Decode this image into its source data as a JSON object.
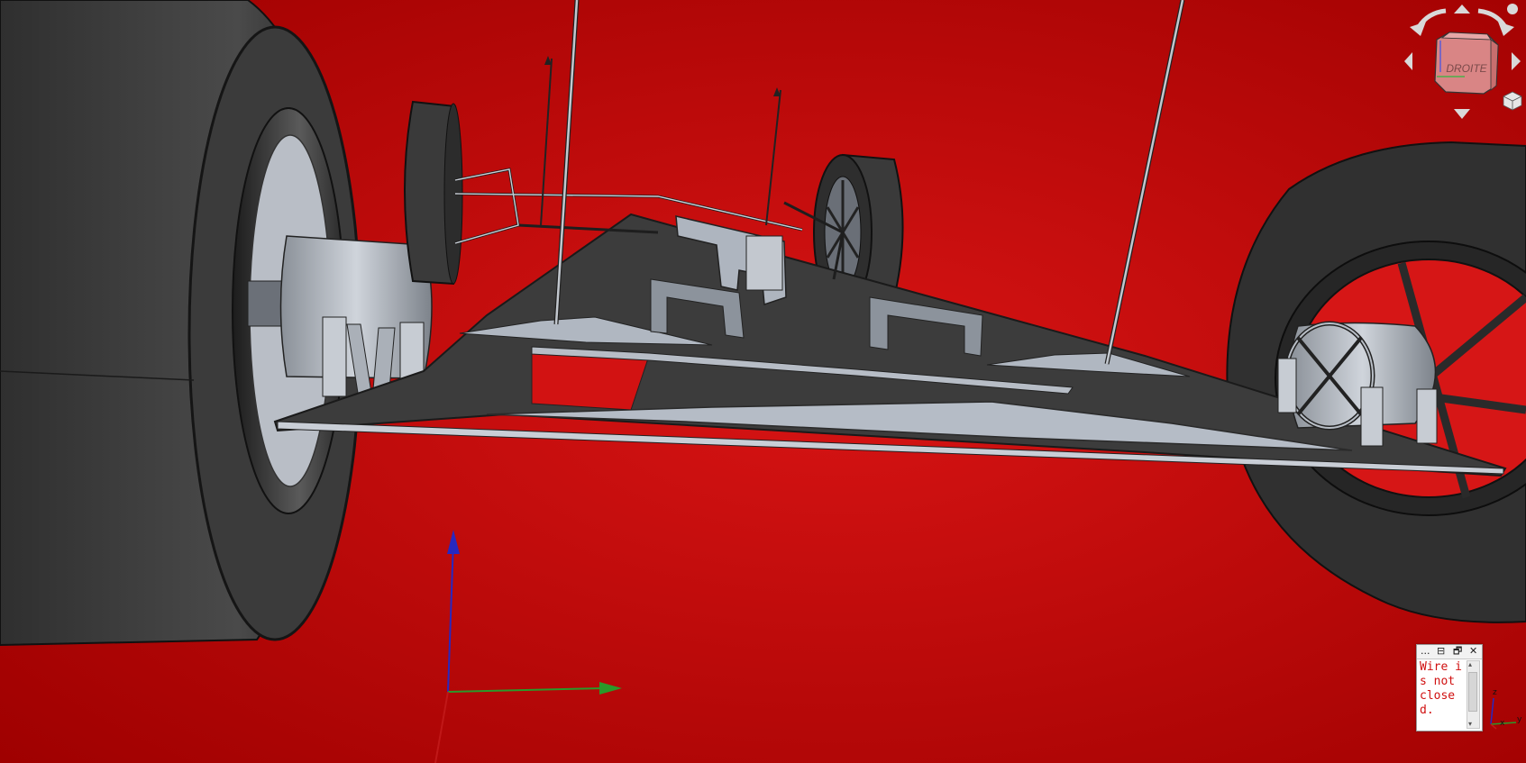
{
  "viewport": {
    "background_top": "#a00000",
    "background_bottom": "#e21818",
    "part_color": "#a7aeb9",
    "dark_color": "#3a3a3a"
  },
  "navigation_cube": {
    "face_label": "DROITE",
    "buttons": [
      "rotate-left",
      "rotate-right",
      "pan-up",
      "pan-down",
      "pan-left",
      "pan-right",
      "home-cube",
      "menu"
    ]
  },
  "report_view": {
    "title_icons": [
      "...",
      "⊟",
      "🗗",
      "✕"
    ],
    "message": "Wire is not closed.",
    "scroll_up": "▴",
    "scroll_down": "▾"
  },
  "axis_indicator": {
    "x_label": "x",
    "y_label": "y",
    "z_label": "z",
    "colors": {
      "x": "#c01818",
      "y": "#2a9a2a",
      "z": "#2828c0"
    }
  }
}
